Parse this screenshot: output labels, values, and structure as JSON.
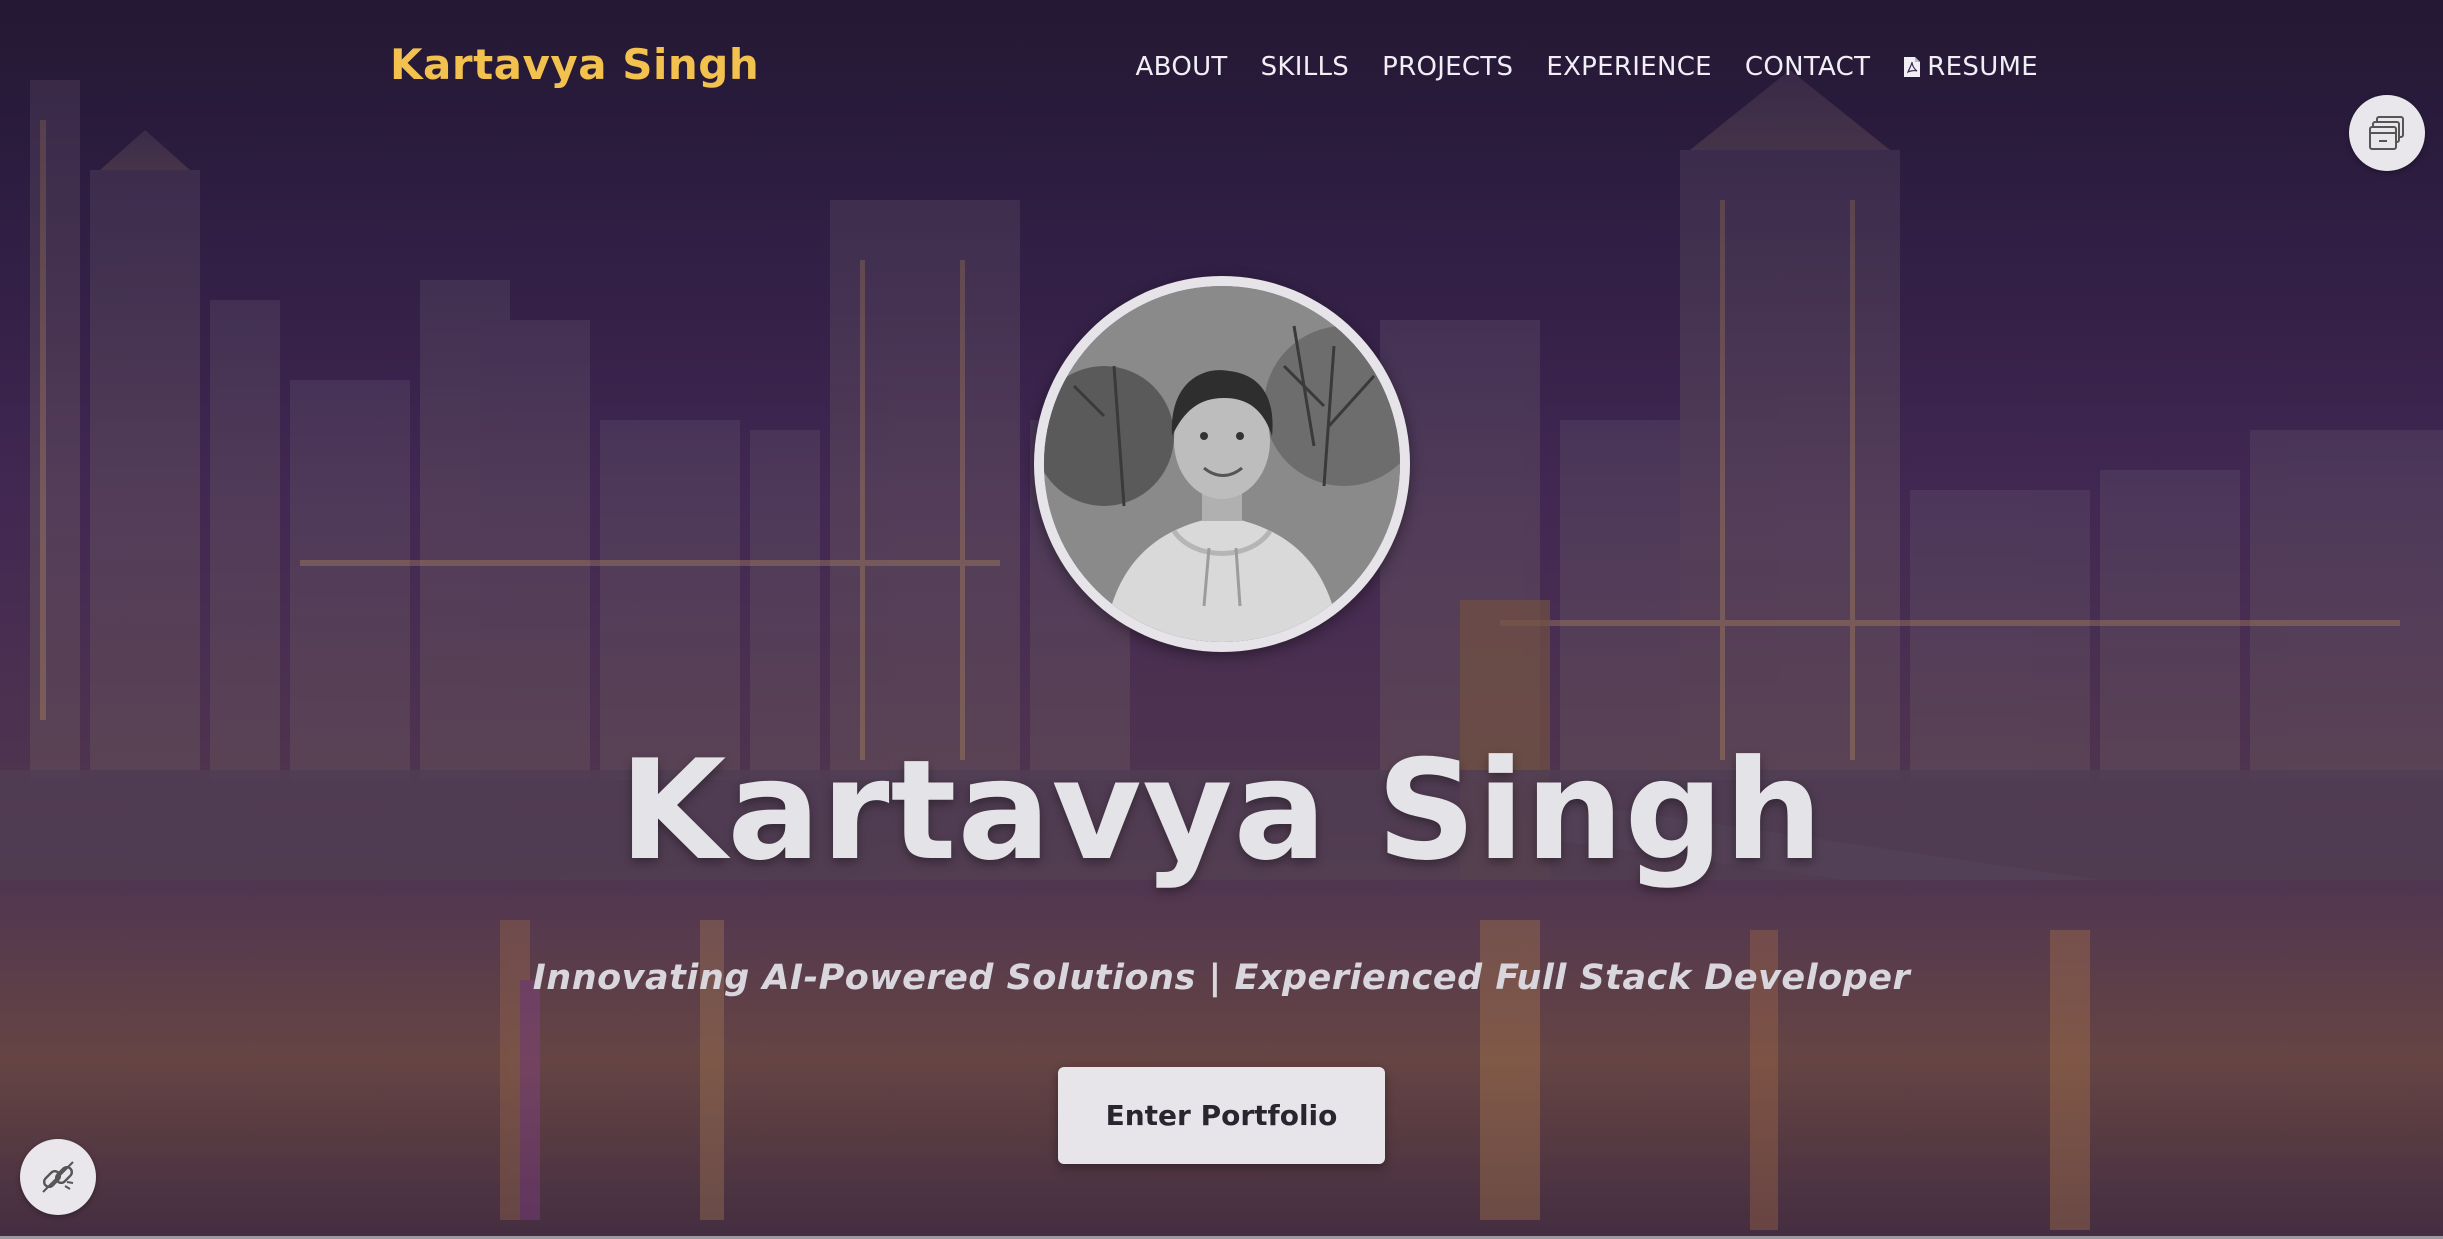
{
  "nav": {
    "brand": "Kartavya Singh",
    "items": [
      {
        "label": "ABOUT"
      },
      {
        "label": "SKILLS"
      },
      {
        "label": "PROJECTS"
      },
      {
        "label": "EXPERIENCE"
      },
      {
        "label": "CONTACT"
      },
      {
        "label": "RESUME",
        "icon": "pdf-file-icon"
      }
    ]
  },
  "hero": {
    "title": "Kartavya Singh",
    "subtitle": "Innovating AI-Powered Solutions | Experienced Full Stack Developer",
    "cta_label": "Enter Portfolio"
  },
  "icons": {
    "top_right": "windows-stack-icon",
    "bottom_left": "link-off-icon"
  },
  "colors": {
    "brand": "#f2c14e",
    "nav_text": "#f1eef5",
    "button_bg": "#e7e5ea"
  }
}
